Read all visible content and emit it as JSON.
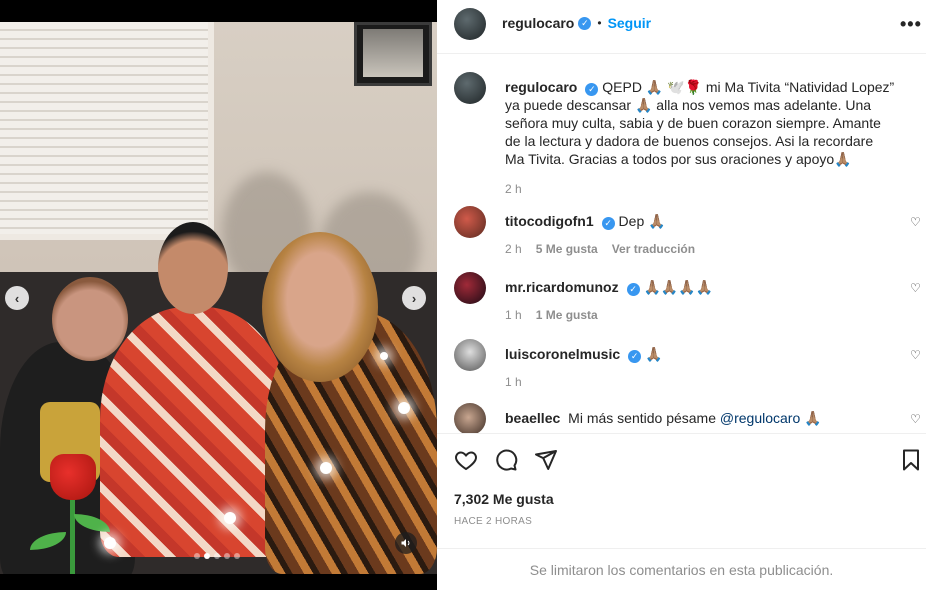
{
  "post": {
    "author": "regulocaro",
    "follow_label": "Seguir",
    "separator": "•",
    "more_icon": "more-horizontal-icon"
  },
  "caption": {
    "username": "regulocaro",
    "text": "QEPD 🙏🏽 🕊️🌹 mi Ma Tivita “Natividad Lopez” ya puede descansar 🙏🏽 alla nos vemos mas adelante. Una señora muy culta, sabia y de buen corazon siempre. Amante de la lectura y dadora de buenos consejos. Asi la recordare Ma Tivita. Gracias a todos por sus oraciones y apoyo🙏🏽",
    "time": "2 h"
  },
  "comments": [
    {
      "username": "titocodigofn1",
      "text": "Dep 🙏🏽",
      "time": "2 h",
      "likes": "5 Me gusta",
      "translate": "Ver traducción"
    },
    {
      "username": "mr.ricardomunoz",
      "text": "🙏🏽🙏🏽🙏🏽🙏🏽",
      "time": "1 h",
      "likes": "1 Me gusta",
      "translate": ""
    },
    {
      "username": "luiscoronelmusic",
      "text": "🙏🏽",
      "time": "1 h",
      "likes": "",
      "translate": ""
    },
    {
      "username": "beaellec",
      "text_before": "Mi más sentido pésame ",
      "mention": "@regulocaro",
      "text_after": " 🙏🏽",
      "time": "",
      "likes": "",
      "translate": ""
    }
  ],
  "actions": {
    "likes": "7,302 Me gusta",
    "posted": "HACE 2 HORAS"
  },
  "footer": {
    "notice": "Se limitaron los comentarios en esta publicación."
  },
  "carousel": {
    "slides_total": 5,
    "active_index": 1,
    "prev_icon": "chevron-left-icon",
    "next_icon": "chevron-right-icon",
    "audio_icon": "speaker-icon"
  },
  "colors": {
    "accent": "#0095f6",
    "verified": "#3897f0",
    "muted_text": "#8e8e8e"
  }
}
